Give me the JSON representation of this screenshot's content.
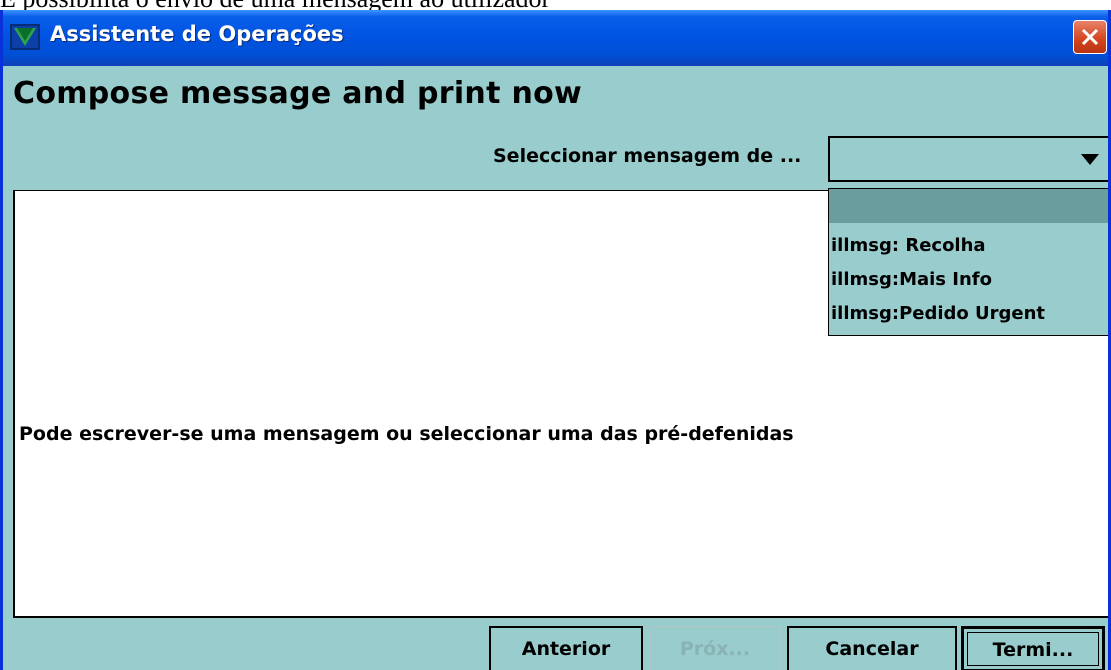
{
  "caption": "É possibilita o envio de uma mensagem ao utilizador",
  "window": {
    "title": "Assistente de Operações",
    "close_icon": "close-icon"
  },
  "heading": "Compose message and print now",
  "select": {
    "label": "Seleccionar mensagem de ...",
    "value": "",
    "options": [
      "",
      "illmsg: Recolha",
      "illmsg:Mais Info",
      "illmsg:Pedido Urgent"
    ]
  },
  "editor": {
    "text": "Pode escrever-se uma mensagem ou seleccionar uma das pré-defenidas"
  },
  "buttons": {
    "previous": "Anterior",
    "next": "Próx...",
    "cancel": "Cancelar",
    "finish": "Termi..."
  },
  "colors": {
    "panel": "#99cccc",
    "titlebar": "#0054e3",
    "selected_option": "#6a9e9e"
  }
}
